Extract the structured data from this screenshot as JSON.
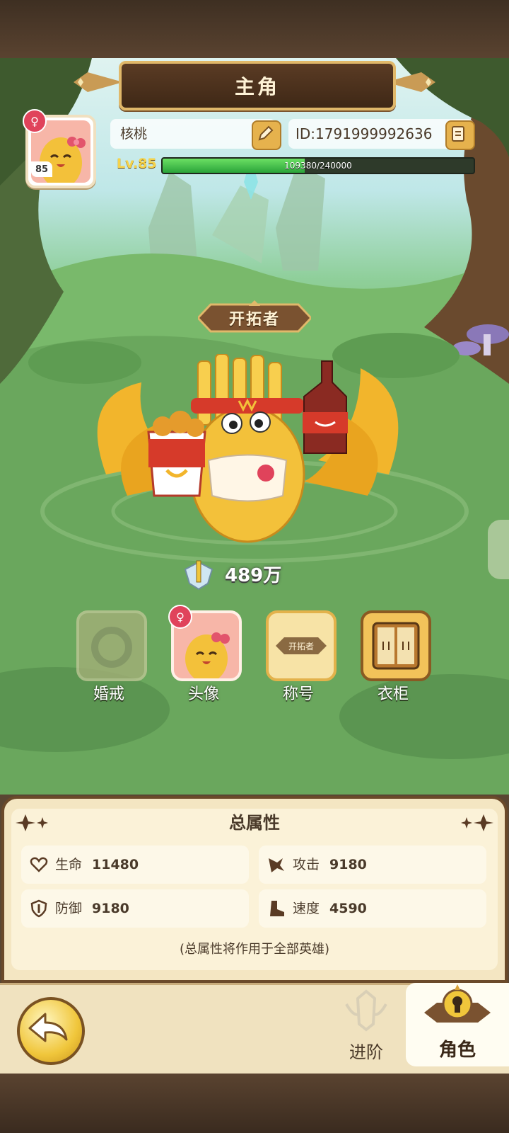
{
  "header": {
    "title": "主角"
  },
  "profile": {
    "name": "核桃",
    "id": "ID:1791999992636",
    "avatar_level": "85",
    "level_label": "Lv.85",
    "xp_text": "109380/240000",
    "xp_progress": 0.456,
    "gender_symbol": "♀"
  },
  "character": {
    "title_badge": "开拓者",
    "power": "489万"
  },
  "options": [
    {
      "label": "婚戒",
      "icon": "ring-icon",
      "enabled": false
    },
    {
      "label": "头像",
      "icon": "avatar-icon",
      "enabled": true
    },
    {
      "label": "称号",
      "icon": "title-icon",
      "enabled": true,
      "badge": "开拓者"
    },
    {
      "label": "衣柜",
      "icon": "wardrobe-icon",
      "enabled": true
    }
  ],
  "stats": {
    "title": "总属性",
    "items": [
      {
        "label": "生命",
        "value": "11480",
        "icon": "heart-icon"
      },
      {
        "label": "攻击",
        "value": "9180",
        "icon": "attack-icon"
      },
      {
        "label": "防御",
        "value": "9180",
        "icon": "shield-icon"
      },
      {
        "label": "速度",
        "value": "4590",
        "icon": "boot-icon"
      }
    ],
    "note": "(总属性将作用于全部英雄)"
  },
  "nav": {
    "back_icon": "back-arrow-icon",
    "tabs": [
      {
        "label": "进阶",
        "icon": "advance-icon",
        "active": false
      },
      {
        "label": "角色",
        "icon": "character-icon",
        "active": true
      }
    ]
  },
  "colors": {
    "accent_gold": "#e6b24d",
    "xp_green": "#2aa33a",
    "panel_bg": "#f4e6c2",
    "gender_pink": "#e0435b"
  }
}
